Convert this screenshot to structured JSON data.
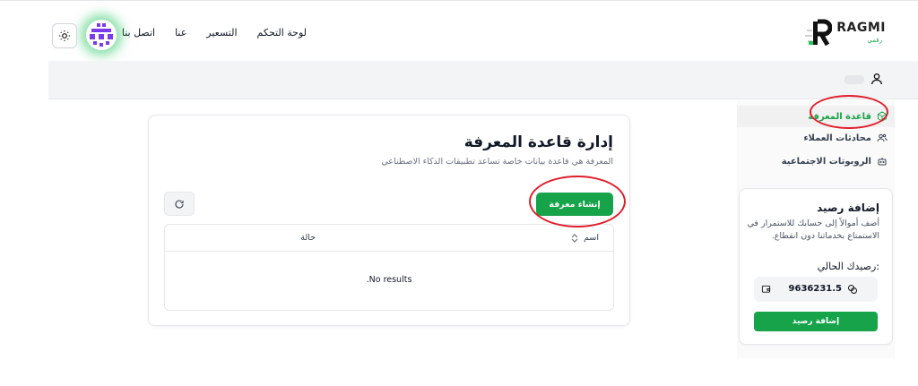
{
  "brand": {
    "name": "RAGMI",
    "subtitle": "رقمي"
  },
  "nav": [
    "لوحة التحكم",
    "التسعير",
    "عنا",
    "اتصل بنا"
  ],
  "sidebar": {
    "items": [
      {
        "label": "قاعدة المعرفة",
        "icon": "cube-icon",
        "active": true
      },
      {
        "label": "محادثات العملاء",
        "icon": "users-icon",
        "active": false
      },
      {
        "label": "الروبوتات الاجتماعية",
        "icon": "bot-icon",
        "active": false
      }
    ]
  },
  "balance": {
    "title": "إضافة رصيد",
    "description": "أضف أموالاً إلى حسابك للاستمرار في الاستمتاع بخدماتنا دون انقطاع.",
    "current_label": "رصيدك الحالي:",
    "value": "9636231.5",
    "button": "إضافة رصيد"
  },
  "main": {
    "title": "إدارة قاعدة المعرفة",
    "description": "المعرفة هي قاعدة بيانات خاصة تساعد تطبيقات الذكاء الاصطناعي",
    "create_button": "إنشاء معرفة",
    "table": {
      "columns": [
        "اسم",
        "حالة"
      ],
      "empty_text": "No results."
    }
  },
  "colors": {
    "accent": "#16a34a",
    "annotation": "#e11d2a"
  }
}
